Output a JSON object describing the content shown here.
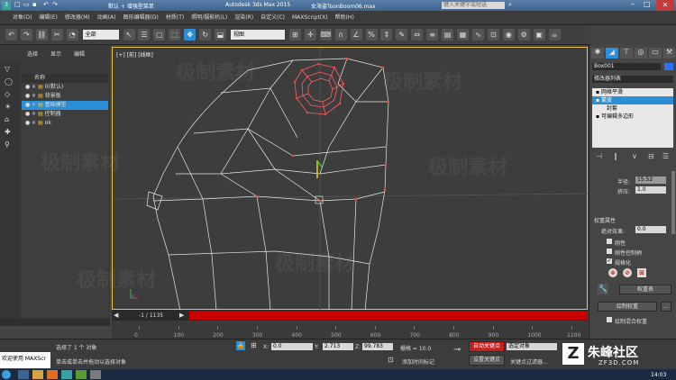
{
  "title": {
    "left": "默认 + 增强型菜单",
    "app": "Autodesk 3ds Max 2015",
    "file": "女海盗ToonBoom06.max",
    "search_placeholder": "键入关键字或短语"
  },
  "menu": [
    "对象(O)",
    "编辑(E)",
    "修改器(M)",
    "动画(A)",
    "图形编辑器(D)",
    "材质(T)",
    "照明/摄影机(L)",
    "渲染(R)",
    "自定义(C)",
    "MAXScript(X)",
    "帮助(H)"
  ],
  "toolbar": {
    "filter": "全部",
    "view": "视图"
  },
  "scene": {
    "tabs": [
      "选择",
      "显示",
      "编辑"
    ],
    "header": "名称",
    "items": [
      {
        "label": "0(默认)",
        "selected": false
      },
      {
        "label": "背景板",
        "selected": false
      },
      {
        "label": "基础模型",
        "selected": true
      },
      {
        "label": "控制器",
        "selected": false
      },
      {
        "label": "ok",
        "selected": false
      }
    ]
  },
  "viewport": {
    "label": "[+] [前] [线框]",
    "frame_counter": "-1 / 1135"
  },
  "watermark": "极制素材",
  "cmd": {
    "object_name": "Box001",
    "modifier_list": "修改器列表",
    "stack": [
      {
        "label": "网格平滑",
        "selected": false
      },
      {
        "label": "蒙皮",
        "selected": true
      },
      {
        "label": "封套",
        "selected": false
      },
      {
        "label": "可编辑多边形",
        "selected": false
      }
    ],
    "radius_label": "半径:",
    "radius_value": "15.52",
    "squash_label": "挤压:",
    "squash_value": "1.0",
    "weight_section": "权重属性",
    "abs_label": "绝对效果:",
    "abs_value": "0.0",
    "rigid": "刚性",
    "rigid_handles": "刚性控制柄",
    "normalize": "规格化",
    "weight_table": "权重表",
    "paint_weights": "绘制权重",
    "paint_blend": "绘制混合权重"
  },
  "ruler_ticks": [
    "0",
    "100",
    "200",
    "300",
    "400",
    "500",
    "600",
    "700",
    "800",
    "900",
    "1000",
    "1100"
  ],
  "status": {
    "listener": "欢迎使用 MAXScr",
    "msg1": "选择了 1 个 对象",
    "msg2": "单击或单击并拖动以选择对象",
    "x_label": "X:",
    "x": "0.0",
    "y_label": "Y:",
    "y": "2.713",
    "z_label": "Z:",
    "z": "99.783",
    "grid": "栅格 = 10.0",
    "add_time_tag": "添加时间标记",
    "auto_key": "自动关键点",
    "set_key": "设置关键点",
    "sel_obj": "选定对象",
    "key_filters": "关键点过滤器..."
  },
  "brand": {
    "name": "朱峰社区",
    "url": "ZF3D.COM"
  },
  "taskbar": {
    "time": "14:03"
  },
  "colors": {
    "accent": "#2a8fd6",
    "timeline": "#c80000",
    "autokey": "#c81e1e"
  }
}
